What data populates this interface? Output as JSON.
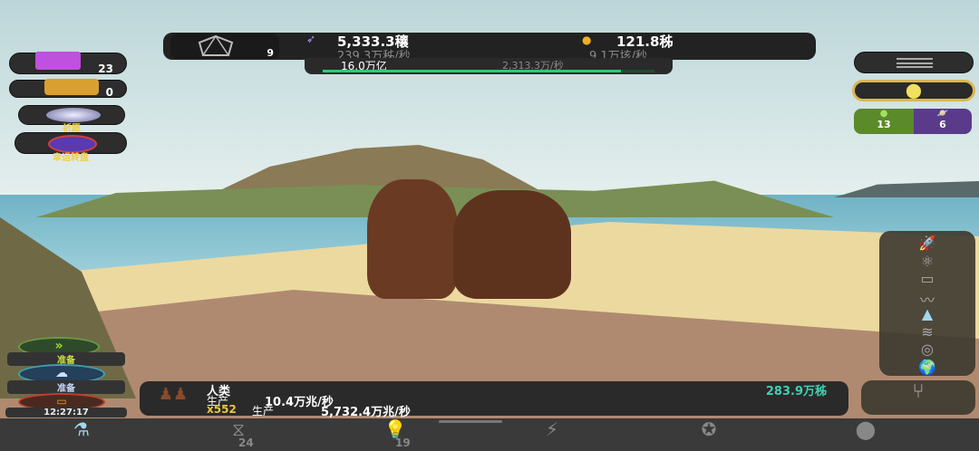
{
  "top_bar": {
    "level": "9",
    "dna_amount": "5,333.3穰",
    "dna_rate": "239.3万秭/秒",
    "idea_amount": "121.8秭",
    "idea_rate": "9.1万垓/秒",
    "entropy_amount": "16.0万亿",
    "entropy_rate": "2,313.3万/秒",
    "entropy_progress": 0.9
  },
  "left_buttons": {
    "cubes": "23",
    "chest": "0",
    "wish": "祈愿",
    "wheel": "幸运转盘",
    "boost": "准备",
    "ghost": "准备",
    "timer": "12:27:17"
  },
  "right_buttons": {
    "green_count": "13",
    "purple_count": "6"
  },
  "side_menu": [
    "rocket-icon",
    "atom-icon",
    "book-icon",
    "dinosaur-icon",
    "mountain-icon",
    "waves-icon",
    "cell-icon",
    "earth-icon"
  ],
  "species_card": {
    "name": "人类",
    "total": "283.9万秭",
    "produce_label": "生产",
    "produce_rate": "10.4万兆/秒",
    "multiplier": "x552",
    "total_rate": "5,732.4万兆/秒"
  },
  "bottom_nav": [
    {
      "icon": "flask-icon",
      "badge": ""
    },
    {
      "icon": "dna-icon",
      "badge": "24"
    },
    {
      "icon": "lightbulb-icon",
      "badge": "19"
    },
    {
      "icon": "lightning-icon",
      "badge": ""
    },
    {
      "icon": "award-icon",
      "badge": ""
    },
    {
      "icon": "mushroom-icon",
      "badge": ""
    }
  ],
  "colors": {
    "accent_green": "#2ecc71",
    "teal": "#3fd0b0",
    "gold": "#e8c840"
  }
}
